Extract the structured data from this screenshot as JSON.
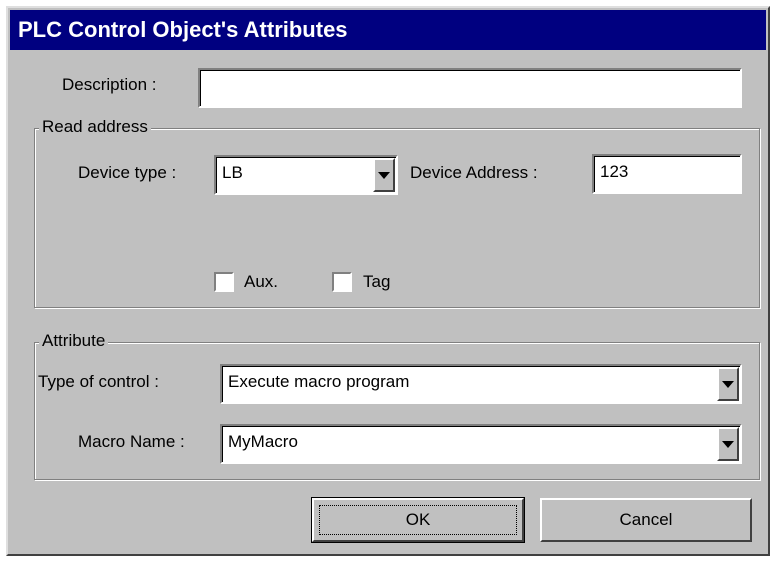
{
  "dialog": {
    "title": "PLC Control Object's Attributes"
  },
  "description": {
    "label": "Description :",
    "value": ""
  },
  "read_address": {
    "legend": "Read address",
    "device_type_label": "Device type :",
    "device_type_value": "LB",
    "device_address_label": "Device Address :",
    "device_address_value": "123",
    "aux_label": "Aux.",
    "aux_checked": false,
    "tag_label": "Tag",
    "tag_checked": false
  },
  "attribute": {
    "legend": "Attribute",
    "type_label": "Type of control :",
    "type_value": "Execute macro program",
    "macro_label": "Macro Name :",
    "macro_value": "MyMacro"
  },
  "buttons": {
    "ok": "OK",
    "cancel": "Cancel"
  },
  "colors": {
    "titlebar": "#000080",
    "dialog_bg": "#c0c0c0"
  },
  "icons": [
    "chevron-down-icon"
  ]
}
